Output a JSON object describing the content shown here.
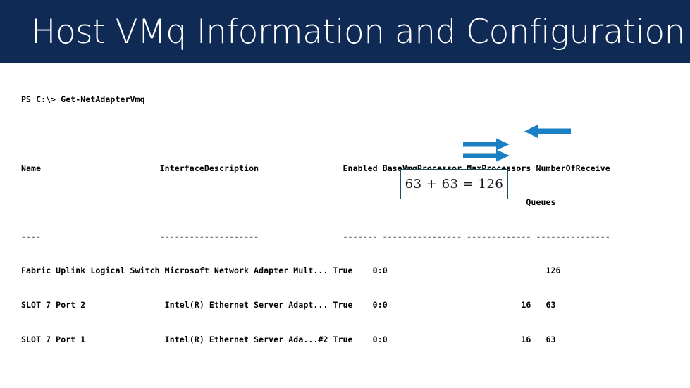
{
  "slide": {
    "title": "Host VMq Information and Configuration",
    "banner_color": "#102A56",
    "background_color": "#FFFFFF"
  },
  "console": {
    "prompt_line": "PS C:\\> Get-NetAdapterVmq",
    "columns": [
      "Name",
      "InterfaceDescription",
      "Enabled",
      "BaseVmqProcessor",
      "MaxProcessors",
      "NumberOfReceive"
    ],
    "header_line_1": "Name                        InterfaceDescription                 Enabled BaseVmqProcessor MaxProcessors NumberOfReceive",
    "header_line_2": "                                                                                                      Queues",
    "separator_line": "----                        --------------------                 ------- ---------------- ------------- ---------------",
    "rows": [
      {
        "name": "Fabric Uplink Logical Switch",
        "interface_description": "Microsoft Network Adapter Mult...",
        "enabled": "True",
        "base_vmq_processor": "0:0",
        "max_processors": "",
        "number_of_receive_queues": "126",
        "text": "Fabric Uplink Logical Switch Microsoft Network Adapter Mult... True    0:0                                126"
      },
      {
        "name": "SLOT 7 Port 2",
        "interface_description": "Intel(R) Ethernet Server Adapt...",
        "enabled": "True",
        "base_vmq_processor": "0:0",
        "max_processors": "16",
        "number_of_receive_queues": "63",
        "text": "SLOT 7 Port 2                Intel(R) Ethernet Server Adapt... True    0:0                           16   63"
      },
      {
        "name": "SLOT 7 Port 1",
        "interface_description": "Intel(R) Ethernet Server Ada...#2",
        "enabled": "True",
        "base_vmq_processor": "0:0",
        "max_processors": "16",
        "number_of_receive_queues": "63",
        "text": "SLOT 7 Port 1                Intel(R) Ethernet Server Ada...#2 True    0:0                           16   63"
      }
    ]
  },
  "annotations": {
    "arrow_color": "#1B7FC4",
    "arrows": [
      {
        "name": "arrow-pointing-to-126",
        "direction": "left",
        "target_value": "126"
      },
      {
        "name": "arrow-pointing-to-63-row2",
        "direction": "right",
        "target_value": "63"
      },
      {
        "name": "arrow-pointing-to-63-row3",
        "direction": "right",
        "target_value": "63"
      }
    ],
    "callout": {
      "text": "63 + 63 = 126",
      "border_color": "#1F5060"
    }
  }
}
